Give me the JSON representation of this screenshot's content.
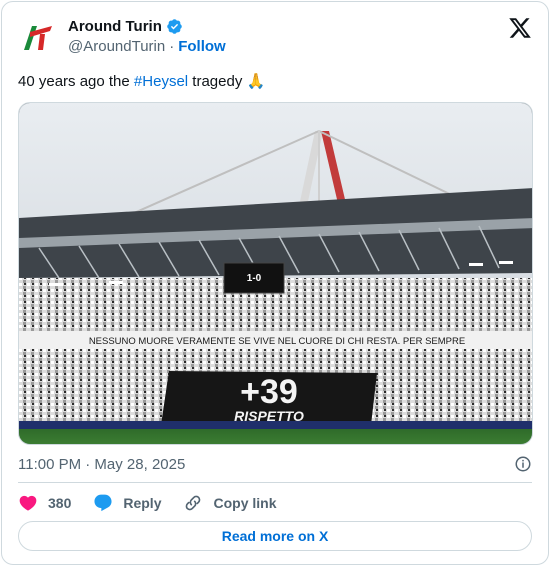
{
  "author": {
    "display_name": "Around Turin",
    "handle": "@AroundTurin",
    "separator": "·",
    "follow_label": "Follow",
    "verified": true
  },
  "tweet": {
    "text_before": "40 years ago the ",
    "hashtag": "#Heysel",
    "text_after": " tragedy 🙏"
  },
  "media": {
    "scoreboard": "1-0",
    "banner_text": "NESSUNO MUORE VERAMENTE SE VIVE NEL CUORE DI CHI RESTA. PER SEMPRE",
    "tifo_number": "+39",
    "tifo_word": "RISPETTO"
  },
  "meta": {
    "timestamp": "11:00 PM · May 28, 2025"
  },
  "actions": {
    "like_count": "380",
    "reply_label": "Reply",
    "copy_link_label": "Copy link"
  },
  "footer": {
    "read_more_label": "Read more on X"
  },
  "colors": {
    "accent": "#006fd6",
    "verified": "#1d9bf0",
    "like": "#f91880",
    "reply": "#1d9bf0",
    "text": "#0f1419",
    "muted": "#536471",
    "border": "#cfd9de"
  },
  "icons": [
    "verified-badge-icon",
    "x-logo-icon",
    "info-icon",
    "heart-icon",
    "reply-bubble-icon",
    "link-icon"
  ]
}
